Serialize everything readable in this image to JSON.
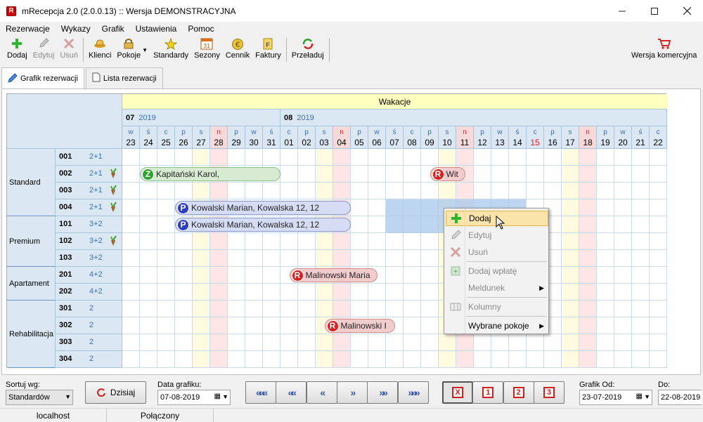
{
  "window": {
    "title": "mRecepcja 2.0  (2.0.0.13)  ::  Wersja DEMONSTRACYJNA",
    "app_icon_letter": "R"
  },
  "menu": [
    "Rezerwacje",
    "Wykazy",
    "Grafik",
    "Ustawienia",
    "Pomoc"
  ],
  "toolbar": {
    "buttons": [
      {
        "label": "Dodaj",
        "icon": "plus-icon",
        "enabled": true
      },
      {
        "label": "Edytuj",
        "icon": "pencil-icon",
        "enabled": false
      },
      {
        "label": "Usuń",
        "icon": "x-icon",
        "enabled": false
      },
      {
        "label": "Klienci",
        "icon": "bell-icon",
        "enabled": true
      },
      {
        "label": "Pokoje",
        "icon": "lock-icon",
        "enabled": true
      },
      {
        "label": "Standardy",
        "icon": "star-icon",
        "enabled": true
      },
      {
        "label": "Sezony",
        "icon": "calendar-icon",
        "enabled": true
      },
      {
        "label": "Cennik",
        "icon": "euro-icon",
        "enabled": true
      },
      {
        "label": "Faktury",
        "icon": "invoice-icon",
        "enabled": true
      },
      {
        "label": "Przeładuj",
        "icon": "reload-icon",
        "enabled": true
      }
    ],
    "commercial_label": "Wersja komercyjna",
    "calendar_icon_text": "31"
  },
  "tabs": [
    {
      "label": "Grafik rezerwacji",
      "active": true
    },
    {
      "label": "Lista rezerwacji",
      "active": false
    }
  ],
  "grid": {
    "season": "Wakacje",
    "months": [
      {
        "month": "07",
        "year": "2019"
      },
      {
        "month": "08",
        "year": "2019"
      }
    ],
    "days": [
      {
        "dow": "w",
        "day": "23"
      },
      {
        "dow": "ś",
        "day": "24"
      },
      {
        "dow": "c",
        "day": "25"
      },
      {
        "dow": "p",
        "day": "26"
      },
      {
        "dow": "s",
        "day": "27"
      },
      {
        "dow": "n",
        "day": "28"
      },
      {
        "dow": "p",
        "day": "29"
      },
      {
        "dow": "w",
        "day": "30"
      },
      {
        "dow": "ś",
        "day": "31"
      },
      {
        "dow": "c",
        "day": "01"
      },
      {
        "dow": "p",
        "day": "02"
      },
      {
        "dow": "s",
        "day": "03"
      },
      {
        "dow": "n",
        "day": "04"
      },
      {
        "dow": "p",
        "day": "05"
      },
      {
        "dow": "w",
        "day": "06"
      },
      {
        "dow": "ś",
        "day": "07"
      },
      {
        "dow": "c",
        "day": "08"
      },
      {
        "dow": "p",
        "day": "09"
      },
      {
        "dow": "s",
        "day": "10"
      },
      {
        "dow": "n",
        "day": "11"
      },
      {
        "dow": "p",
        "day": "12"
      },
      {
        "dow": "w",
        "day": "13"
      },
      {
        "dow": "ś",
        "day": "14"
      },
      {
        "dow": "c",
        "day": "15"
      },
      {
        "dow": "p",
        "day": "16"
      },
      {
        "dow": "s",
        "day": "17"
      },
      {
        "dow": "n",
        "day": "18"
      },
      {
        "dow": "p",
        "day": "19"
      },
      {
        "dow": "w",
        "day": "20"
      },
      {
        "dow": "ś",
        "day": "21"
      },
      {
        "dow": "c",
        "day": "22"
      }
    ],
    "groups": [
      {
        "name": "Standard",
        "rooms": 4
      },
      {
        "name": "Premium",
        "rooms": 3
      },
      {
        "name": "Apartament",
        "rooms": 2
      },
      {
        "name": "Rehabilitacja",
        "rooms": 4
      }
    ],
    "rooms": [
      {
        "number": "001",
        "capacity": "2+1",
        "plant": false
      },
      {
        "number": "002",
        "capacity": "2+1",
        "plant": true
      },
      {
        "number": "003",
        "capacity": "2+1",
        "plant": true
      },
      {
        "number": "004",
        "capacity": "2+1",
        "plant": true
      },
      {
        "number": "101",
        "capacity": "3+2",
        "plant": false
      },
      {
        "number": "102",
        "capacity": "3+2",
        "plant": true
      },
      {
        "number": "103",
        "capacity": "3+2",
        "plant": false
      },
      {
        "number": "201",
        "capacity": "4+2",
        "plant": false
      },
      {
        "number": "202",
        "capacity": "4+2",
        "plant": false
      },
      {
        "number": "301",
        "capacity": "2",
        "plant": false
      },
      {
        "number": "302",
        "capacity": "2",
        "plant": false
      },
      {
        "number": "303",
        "capacity": "2",
        "plant": false
      },
      {
        "number": "304",
        "capacity": "2",
        "plant": false
      }
    ],
    "reservations": [
      {
        "row": 1,
        "start": 1,
        "end": 9,
        "status": "Z",
        "text": "Kapitański Karol,",
        "color": "#d6ebd2",
        "border": "#8fbf88",
        "badge": "#2ea32e"
      },
      {
        "row": 1,
        "start": 17.5,
        "end": 19.5,
        "status": "R",
        "text": "Wit",
        "color": "#f3cdcd",
        "border": "#d08b8b",
        "badge": "#d62020"
      },
      {
        "row": 3,
        "start": 3,
        "end": 13,
        "status": "P",
        "text": "Kowalski Marian, Kowalska 12, 12",
        "color": "#d6dcf3",
        "border": "#8a95cf",
        "badge": "#2a3cc8"
      },
      {
        "row": 4,
        "start": 3,
        "end": 13,
        "status": "P",
        "text": "Kowalski Marian, Kowalska 12, 12",
        "color": "#d6dcf3",
        "border": "#8a95cf",
        "badge": "#2a3cc8"
      },
      {
        "row": 7,
        "start": 9.5,
        "end": 14.5,
        "status": "R",
        "text": "Malinowski Maria",
        "color": "#f3cdcd",
        "border": "#d08b8b",
        "badge": "#d62020"
      },
      {
        "row": 10,
        "start": 11.5,
        "end": 15.5,
        "status": "R",
        "text": "Malinowski I",
        "color": "#f3cdcd",
        "border": "#d08b8b",
        "badge": "#d62020"
      }
    ],
    "selection": {
      "rows": [
        3,
        4
      ],
      "start": 15,
      "end": 23
    }
  },
  "context_menu": {
    "items": [
      {
        "label": "Dodaj",
        "enabled": true,
        "highlighted": true,
        "submenu": false,
        "icon": "plus-icon"
      },
      {
        "label": "Edytuj",
        "enabled": false,
        "highlighted": false,
        "submenu": false,
        "icon": "pencil-icon"
      },
      {
        "label": "Usuń",
        "enabled": false,
        "highlighted": false,
        "submenu": false,
        "icon": "x-icon"
      },
      {
        "label": "Dodaj wpłatę",
        "enabled": false,
        "highlighted": false,
        "submenu": false,
        "icon": "payment-icon"
      },
      {
        "label": "Meldunek",
        "enabled": false,
        "highlighted": false,
        "submenu": true,
        "icon": ""
      },
      {
        "label": "Kolumny",
        "enabled": false,
        "highlighted": false,
        "submenu": false,
        "icon": "columns-icon"
      },
      {
        "label": "Wybrane pokoje",
        "enabled": true,
        "highlighted": false,
        "submenu": true,
        "icon": ""
      }
    ]
  },
  "bottom": {
    "sort_label": "Sortuj wg:",
    "sort_value": "Standardów",
    "today_button": "Dzisiaj",
    "date_label": "Data grafiku:",
    "date_value": "07-08-2019",
    "nav_buttons": [
      "«««",
      "««",
      "«",
      "»",
      "»»",
      "»»»"
    ],
    "view_buttons": [
      "X",
      "1",
      "2",
      "3"
    ],
    "from_label": "Grafik Od:",
    "from_value": "23-07-2019",
    "to_label": "Do:",
    "to_value": "22-08-2019"
  },
  "status": {
    "host": "localhost",
    "connection": "Połączony"
  },
  "colors": {
    "header_blue": "#dbe8f4",
    "season_yellow": "#ffffc0",
    "weekend_saturday": "#fffbe0",
    "weekend_sunday": "#ffe6e6",
    "selection": "#a9c8ec",
    "sunday_text": "#d22"
  }
}
